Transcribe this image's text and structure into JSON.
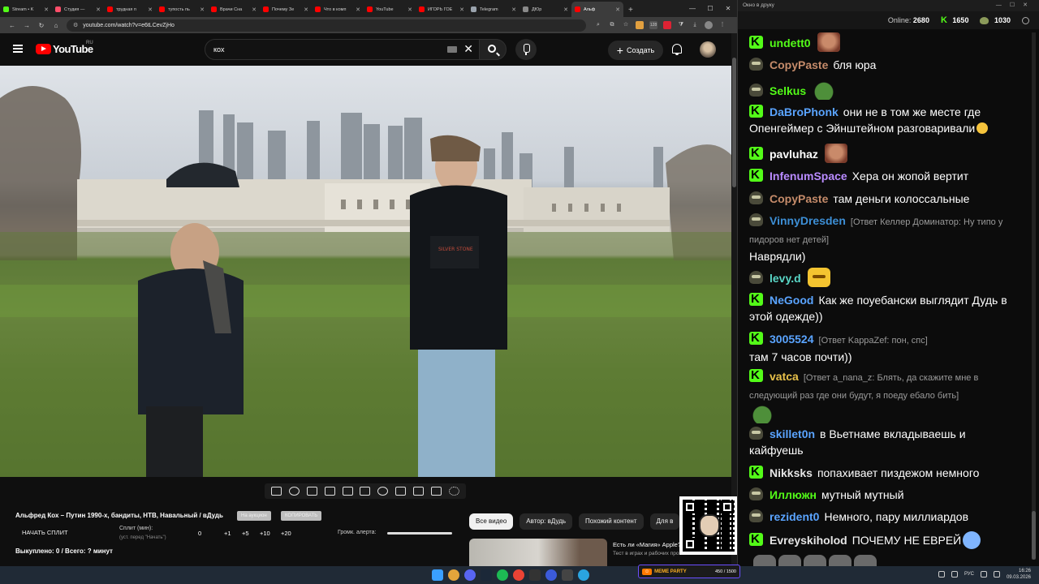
{
  "browser": {
    "tabs": [
      {
        "label": "Stream • K",
        "color": "#53fc18"
      },
      {
        "label": "Студия —",
        "color": "#ff4e6a"
      },
      {
        "label": "трудная п",
        "color": "#ff0000"
      },
      {
        "label": "тупость пь",
        "color": "#ff0000"
      },
      {
        "label": "Врачи Сна",
        "color": "#ff0000"
      },
      {
        "label": "Почему Зе",
        "color": "#ff0000"
      },
      {
        "label": "Что в комп",
        "color": "#ff0000"
      },
      {
        "label": "YouTube",
        "color": "#ff0000"
      },
      {
        "label": "ИГОРЬ ГОЕ",
        "color": "#ff0000"
      },
      {
        "label": "Telegram",
        "color": "#9aa3ad"
      },
      {
        "label": "ДЮр",
        "color": "#8a8a8a"
      },
      {
        "label": "Альф",
        "color": "#ff0000",
        "active": true
      }
    ],
    "url": "youtube.com/watch?v=e6tLCevZjHo",
    "extension_badge": "128"
  },
  "youtube": {
    "brand": "YouTube",
    "region": "RU",
    "search_query": "кох",
    "create_label": "Создать"
  },
  "below_player": {
    "video_title": "Альфред Кох – Путин 1990-х, бандиты, НТВ, Навальный / вДудь",
    "tag_auction": "На аукцион",
    "tag_copy": "КОПИРОВАТЬ",
    "start_split": "НАЧАТЬ СПЛИТ",
    "split_label": "Сплит (мин):",
    "split_hint": "(уст. перед \"Начать\")",
    "split_values": [
      "0",
      "+1",
      "+5",
      "+10",
      "+20"
    ],
    "alert_volume_label": "Громк. алерта:",
    "bought_status": "Выкуплено: 0 / Всего: ? минут",
    "filters": [
      "Все видео",
      "Автор: вДудь",
      "Похожий контент",
      "Для в"
    ],
    "rec_title_1": "Есть ли «Магия» Apple?",
    "rec_title_2": "Тест в играх и рабочих про..."
  },
  "chat": {
    "window_title": "Окно в друку",
    "online_label": "Online:",
    "online_count": "2680",
    "kick_count": "1650",
    "yt_count": "1030",
    "colors": {
      "kick": "#53fc18",
      "youtube_user": "#c8a27a"
    },
    "messages": [
      {
        "src": "kick",
        "user": "undett0",
        "color": "#53fc18",
        "text": "",
        "emote": "face"
      },
      {
        "src": "youtube",
        "user": "CopyPaste",
        "color": "#c58b6a",
        "text": "бля юра"
      },
      {
        "src": "youtube",
        "user": "Selkus",
        "color": "#53fc18",
        "text": "",
        "emote": "pepe"
      },
      {
        "src": "kick",
        "user": "DaBroPhonk",
        "color": "#5aa4ff",
        "text": "они не в том же месте где Опенгеймер с Эйнштейном разговаривали",
        "emote": "think"
      },
      {
        "src": "kick",
        "user": "pavluhaz",
        "color": "#ffffff",
        "text": "",
        "emote": "face"
      },
      {
        "src": "kick",
        "user": "InfenumSpace",
        "color": "#b98bff",
        "text": "Хера он жопой вертит"
      },
      {
        "src": "youtube",
        "user": "CopyPaste",
        "color": "#c58b6a",
        "text": "там деньги колоссальные"
      },
      {
        "src": "youtube",
        "user": "VinnyDresden",
        "color": "#3d8fd6",
        "reply": "[Ответ Келлер Доминатор: Ну типо у пидоров нет детей]",
        "text": "Наврядли)"
      },
      {
        "src": "youtube",
        "user": "levy.d",
        "color": "#59d6c6",
        "text": "",
        "emote": "lol"
      },
      {
        "src": "kick",
        "user": "NeGood",
        "color": "#5aa4ff",
        "text": "Как же поуебански выглядит Дудь в этой одежде))"
      },
      {
        "src": "kick",
        "user": "3005524",
        "color": "#5aa4ff",
        "reply": "[Ответ KappaZef: пон, спс]",
        "text": "там 7 часов почти))"
      },
      {
        "src": "kick",
        "user": "vatca",
        "color": "#e8c14a",
        "reply": "[Ответ a_nana_z: Блять, да скажите мне в следующий раз где они будут, я поеду ебало бить]",
        "text": "",
        "emote": "pepe"
      },
      {
        "src": "youtube",
        "user": "skillet0n",
        "color": "#5aa4ff",
        "text": "в Вьетнаме вкладываешь и кайфуешь"
      },
      {
        "src": "kick",
        "user": "Nikksks",
        "color": "#e6e6e6",
        "text": "попахивает пиздежом немного"
      },
      {
        "src": "youtube",
        "user": "Иллюжн",
        "color": "#53fc18",
        "text": "мутный мутный"
      },
      {
        "src": "youtube",
        "user": "rezident0",
        "color": "#5aa4ff",
        "text": "Немного, пару миллиардов"
      },
      {
        "src": "kick",
        "user": "Evreyskiholod",
        "color": "#e6e6e6",
        "text": "ПОЧЕМУ НЕ ЕВРЕЙ",
        "emote": "cry"
      }
    ]
  },
  "meme_party": {
    "label": "MEME PARTY",
    "count": "450 / 1500"
  },
  "taskbar": {
    "lang": "РУС",
    "time": "16:26",
    "date": "09.03.2026"
  }
}
